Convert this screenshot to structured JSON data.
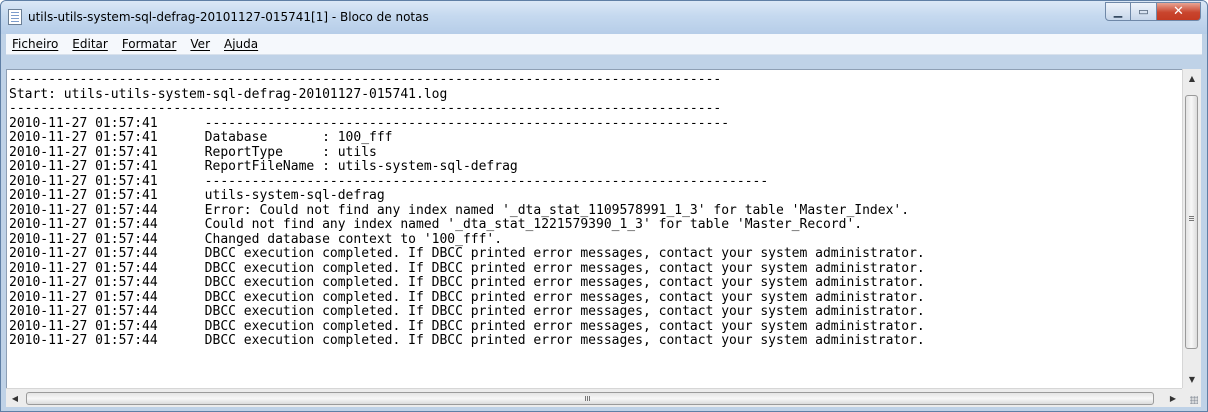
{
  "window": {
    "title": "utils-utils-system-sql-defrag-20101127-015741[1] - Bloco de notas",
    "caption": {
      "minimize": "▁",
      "maximize": "▭",
      "close": "✕"
    }
  },
  "menu": [
    {
      "label": "Ficheiro"
    },
    {
      "label": "Editar"
    },
    {
      "label": "Formatar"
    },
    {
      "label": "Ver"
    },
    {
      "label": "Ajuda"
    }
  ],
  "editor": {
    "lines": [
      "-------------------------------------------------------------------------------------------",
      "Start: utils-utils-system-sql-defrag-20101127-015741.log",
      "-------------------------------------------------------------------------------------------",
      "2010-11-27 01:57:41      -------------------------------------------------------------------",
      "2010-11-27 01:57:41      Database       : 100_fff",
      "2010-11-27 01:57:41      ReportType     : utils",
      "2010-11-27 01:57:41      ReportFileName : utils-system-sql-defrag",
      "2010-11-27 01:57:41      ------------------------------------------------------------------------",
      "2010-11-27 01:57:41      utils-system-sql-defrag",
      "2010-11-27 01:57:44      Error: Could not find any index named '_dta_stat_1109578991_1_3' for table 'Master_Index'.",
      "2010-11-27 01:57:44      Could not find any index named '_dta_stat_1221579390_1_3' for table 'Master_Record'.",
      "2010-11-27 01:57:44      Changed database context to '100_fff'.",
      "2010-11-27 01:57:44      DBCC execution completed. If DBCC printed error messages, contact your system administrator.",
      "2010-11-27 01:57:44      DBCC execution completed. If DBCC printed error messages, contact your system administrator.",
      "2010-11-27 01:57:44      DBCC execution completed. If DBCC printed error messages, contact your system administrator.",
      "2010-11-27 01:57:44      DBCC execution completed. If DBCC printed error messages, contact your system administrator.",
      "2010-11-27 01:57:44      DBCC execution completed. If DBCC printed error messages, contact your system administrator.",
      "2010-11-27 01:57:44      DBCC execution completed. If DBCC printed error messages, contact your system administrator.",
      "2010-11-27 01:57:44      DBCC execution completed. If DBCC printed error messages, contact your system administrator."
    ]
  },
  "scrollbars": {
    "vertical": {
      "up": "▲",
      "down": "▼"
    },
    "horizontal": {
      "left": "◀",
      "right": "▶",
      "grip": "III"
    }
  },
  "colors": {
    "titlebar": "#c5d9ef",
    "close_button": "#c9452e",
    "editor_bg": "#ffffff"
  }
}
